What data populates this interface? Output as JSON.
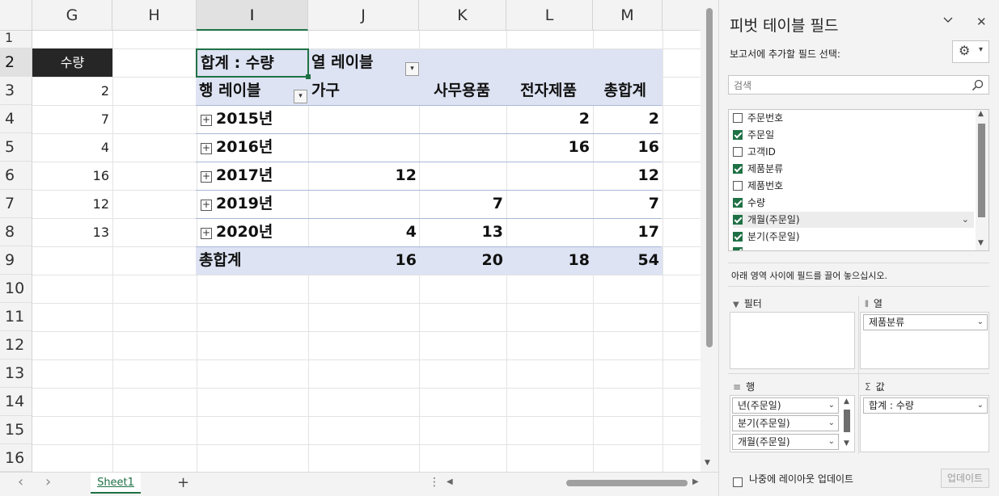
{
  "columns": [
    "G",
    "H",
    "I",
    "J",
    "K",
    "L",
    "M"
  ],
  "rows": [
    "1",
    "2",
    "3",
    "4",
    "5",
    "6",
    "7",
    "8",
    "9",
    "10",
    "11",
    "12",
    "13",
    "14",
    "15",
    "16"
  ],
  "g_column": {
    "header": "수량",
    "values": [
      "2",
      "7",
      "4",
      "16",
      "12",
      "13"
    ]
  },
  "pivot": {
    "corner_label": "합계 : 수량",
    "col_labels_title": "열 레이블",
    "row_labels_title": "행 레이블",
    "categories": [
      "가구",
      "사무용품",
      "전자제품",
      "총합계"
    ],
    "rows": [
      {
        "label": "2015년",
        "values": [
          "",
          "",
          "2",
          "2"
        ]
      },
      {
        "label": "2016년",
        "values": [
          "",
          "",
          "16",
          "16"
        ]
      },
      {
        "label": "2017년",
        "values": [
          "12",
          "",
          "",
          "12"
        ]
      },
      {
        "label": "2019년",
        "values": [
          "",
          "7",
          "",
          "7"
        ]
      },
      {
        "label": "2020년",
        "values": [
          "4",
          "13",
          "",
          "17"
        ]
      }
    ],
    "total": {
      "label": "총합계",
      "values": [
        "16",
        "20",
        "18",
        "54"
      ]
    },
    "expand_glyph": "+",
    "dropdown_glyph": "▾"
  },
  "tabs": {
    "sheet": "Sheet1",
    "add": "+",
    "prev": "‹",
    "next": "›",
    "more": "⋮"
  },
  "pane": {
    "title": "피벗 테이블 필드",
    "choose_label": "보고서에 추가할 필드 선택:",
    "search_placeholder": "검색",
    "fields": [
      {
        "name": "주문번호",
        "checked": false
      },
      {
        "name": "주문일",
        "checked": true
      },
      {
        "name": "고객ID",
        "checked": false
      },
      {
        "name": "제품분류",
        "checked": true
      },
      {
        "name": "제품번호",
        "checked": false
      },
      {
        "name": "수량",
        "checked": true
      },
      {
        "name": "개월(주문일)",
        "checked": true
      },
      {
        "name": "분기(주문일)",
        "checked": true
      }
    ],
    "drag_hint": "아래 영역 사이에 필드를 끌어 놓으십시오.",
    "areas": {
      "filter": "필터",
      "columns": "열",
      "rows": "행",
      "values": "값"
    },
    "column_fields": [
      "제품분류"
    ],
    "row_fields": [
      "년(주문일)",
      "분기(주문일)",
      "개월(주문일)"
    ],
    "value_fields": [
      "합계 : 수량"
    ],
    "defer_label": "나중에 레이아웃 업데이트",
    "update_button": "업데이트",
    "icons": {
      "collapse": "⌵",
      "close": "✕",
      "gear": "⚙",
      "chevron": "⌄",
      "filter": "▼",
      "columns": "⦀",
      "rows": "≡",
      "sigma": "Σ"
    }
  }
}
